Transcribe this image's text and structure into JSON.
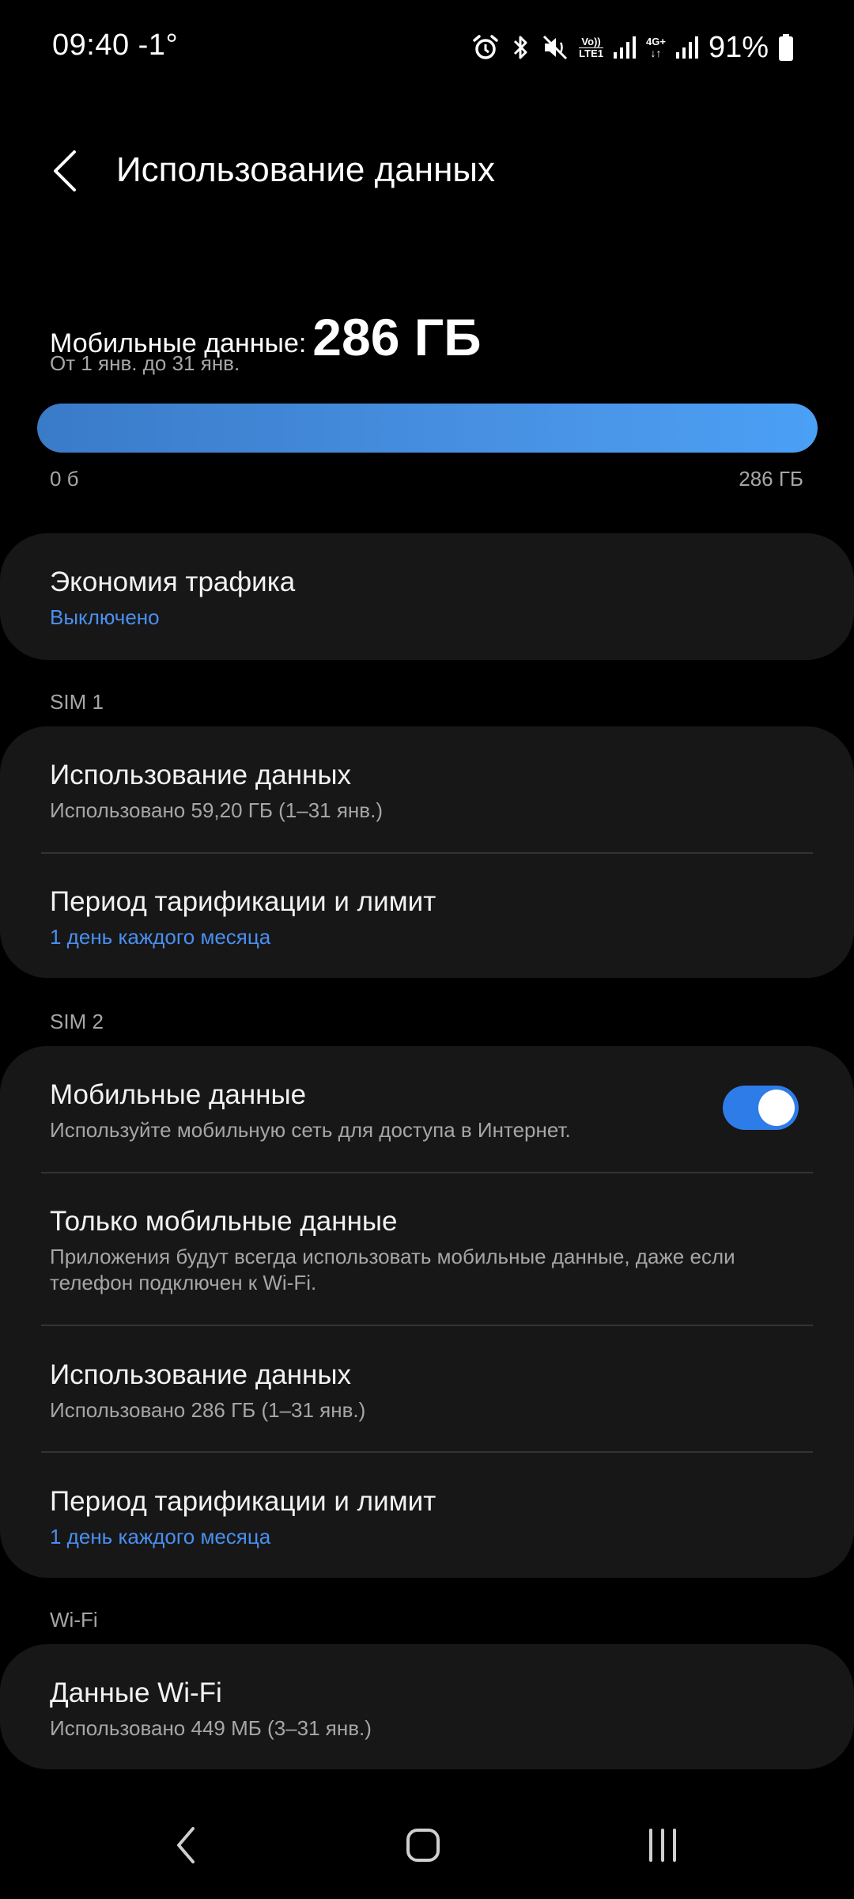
{
  "status_bar": {
    "time": "09:40",
    "temperature": "-1°",
    "lte_label_top": "Vo))",
    "lte_label_bottom": "LTE1",
    "network_label": "4G+",
    "battery_percent": "91%",
    "icons": [
      "alarm-icon",
      "bluetooth-icon",
      "mute-icon",
      "volte-icon",
      "signal-icon",
      "4g-icon",
      "signal-icon",
      "battery-icon"
    ]
  },
  "header": {
    "title": "Использование данных"
  },
  "summary": {
    "label": "Мобильные данные:",
    "value": "286 ГБ",
    "period": "От 1 янв. до 31 янв.",
    "progress_fraction": 1.0,
    "min_label": "0 б",
    "max_label": "286 ГБ"
  },
  "data_saver": {
    "title": "Экономия трафика",
    "status": "Выключено"
  },
  "sim1": {
    "section_label": "SIM 1",
    "usage_title": "Использование данных",
    "usage_sub": "Использовано 59,20 ГБ (1–31 янв.)",
    "billing_title": "Период тарификации и лимит",
    "billing_sub": "1 день каждого месяца"
  },
  "sim2": {
    "section_label": "SIM 2",
    "mobile_data_title": "Мобильные данные",
    "mobile_data_sub": "Используйте мобильную сеть для доступа в Интернет.",
    "mobile_data_enabled": true,
    "only_mobile_title": "Только мобильные данные",
    "only_mobile_sub": "Приложения будут всегда использовать мобильные данные, даже если телефон подключен к Wi-Fi.",
    "usage_title": "Использование данных",
    "usage_sub": "Использовано 286 ГБ (1–31 янв.)",
    "billing_title": "Период тарификации и лимит",
    "billing_sub": "1 день каждого месяца"
  },
  "wifi": {
    "section_label": "Wi-Fi",
    "title": "Данные Wi-Fi",
    "sub": "Использовано 449 МБ (3–31 янв.)"
  },
  "colors": {
    "accent": "#4a8ff0",
    "toggle_on": "#2e7ce8",
    "card_bg": "#171717",
    "background": "#000000"
  },
  "nav_bar": {
    "icons": [
      "back-icon",
      "home-icon",
      "recents-icon"
    ]
  }
}
